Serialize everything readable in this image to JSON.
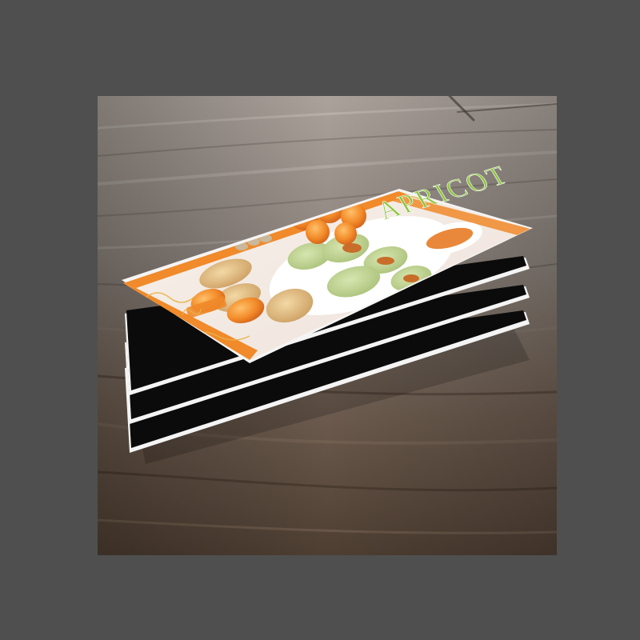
{
  "image": {
    "subject": "stacked-printed-boards-on-wood-floor",
    "colors": {
      "background": "#4f4f4f",
      "wood_light": "#b8ada4",
      "wood_dark": "#4a3b30",
      "accent_orange": "#f08a2a",
      "title_green": "#8cc63f",
      "board_black": "#0a0a0a",
      "board_edge": "#f4f4f4"
    }
  },
  "poster": {
    "title": "APRICOT"
  }
}
